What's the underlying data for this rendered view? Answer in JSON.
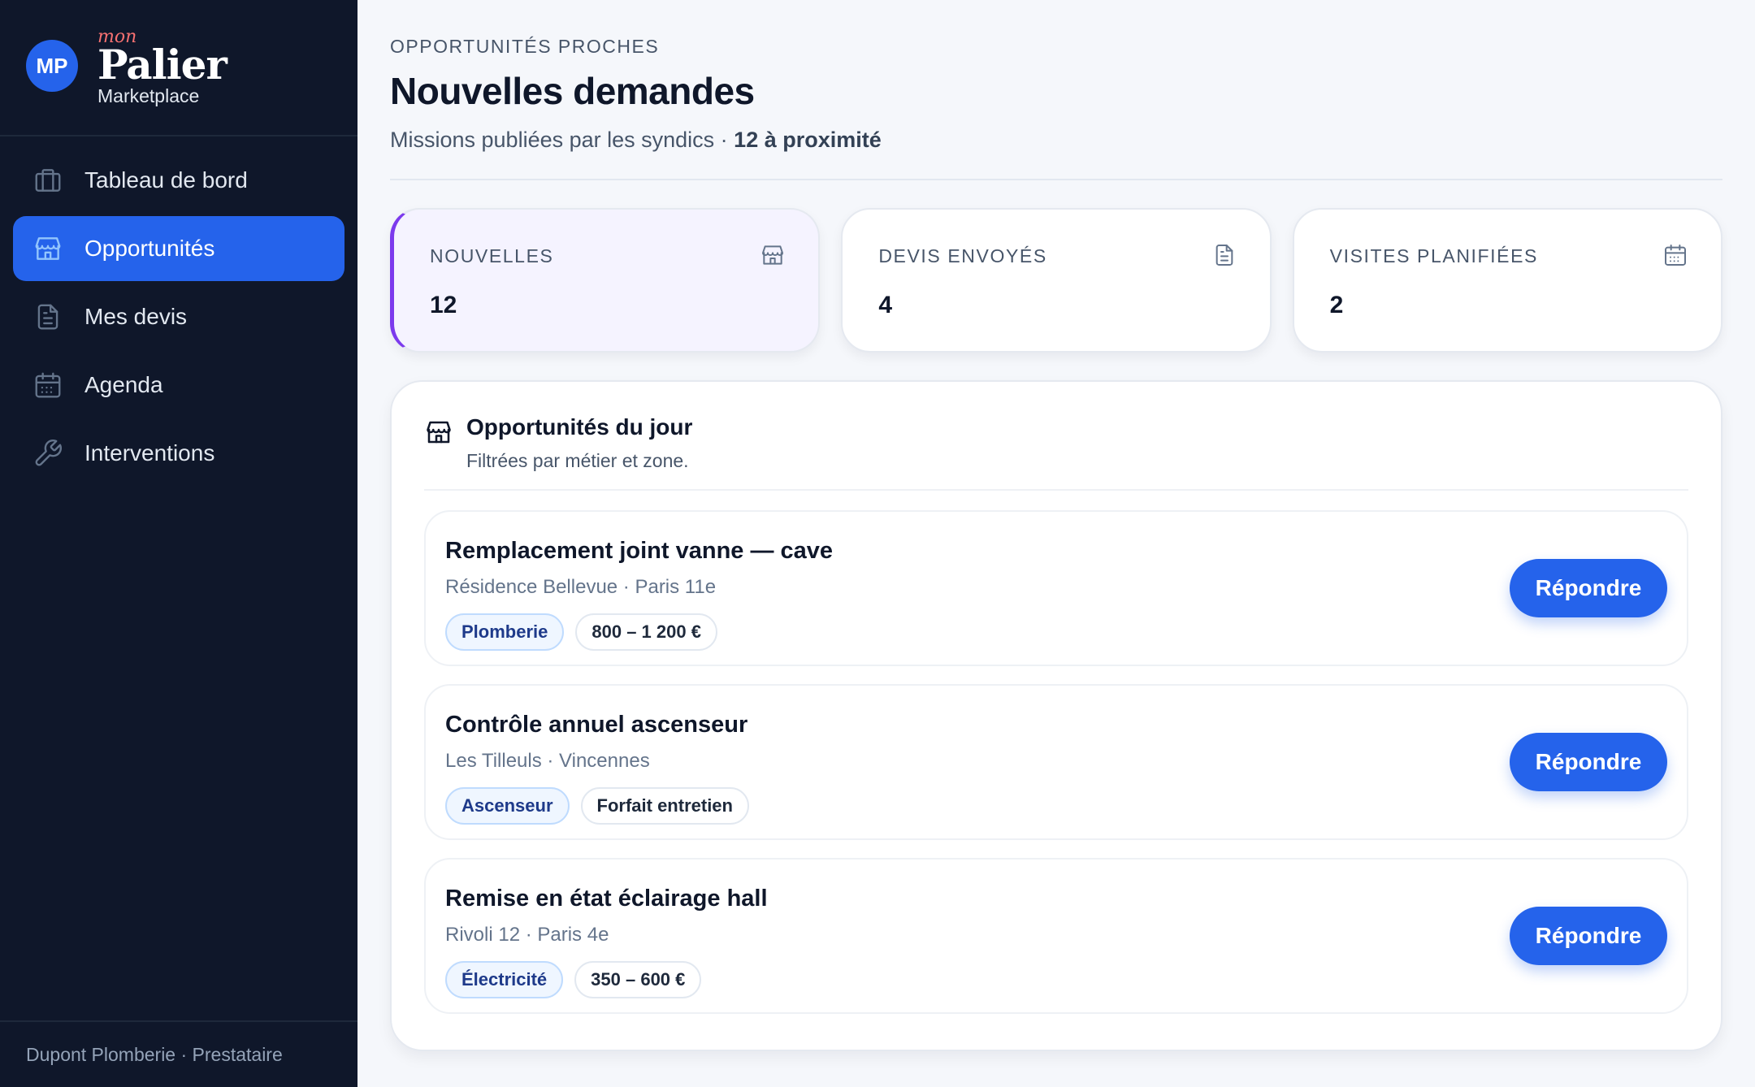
{
  "brand": {
    "initials": "MP",
    "mon": "mon",
    "name": "Palier",
    "sub": "Marketplace"
  },
  "nav": [
    {
      "label": "Tableau de bord",
      "icon": "briefcase-icon",
      "active": false
    },
    {
      "label": "Opportunités",
      "icon": "storefront-icon",
      "active": true
    },
    {
      "label": "Mes devis",
      "icon": "document-icon",
      "active": false
    },
    {
      "label": "Agenda",
      "icon": "calendar-icon",
      "active": false
    },
    {
      "label": "Interventions",
      "icon": "wrench-icon",
      "active": false
    }
  ],
  "footer": {
    "user": "Dupont Plomberie · Prestataire"
  },
  "header": {
    "eyebrow": "OPPORTUNITÉS PROCHES",
    "title": "Nouvelles demandes",
    "subtitle": "Missions publiées par les syndics · ",
    "subtitle_strong": "12 à proximité"
  },
  "stats": [
    {
      "label": "NOUVELLES",
      "value": "12",
      "icon": "storefront-icon"
    },
    {
      "label": "DEVIS ENVOYÉS",
      "value": "4",
      "icon": "document-icon"
    },
    {
      "label": "VISITES PLANIFIÉES",
      "value": "2",
      "icon": "calendar-icon"
    }
  ],
  "daily": {
    "title": "Opportunités du jour",
    "subtitle": "Filtrées par métier et zone.",
    "items": [
      {
        "title": "Remplacement joint vanne — cave",
        "location": "Résidence Bellevue · Paris 11e",
        "trade": "Plomberie",
        "price": "800 – 1 200 €",
        "action": "Répondre"
      },
      {
        "title": "Contrôle annuel ascenseur",
        "location": "Les Tilleuls · Vincennes",
        "trade": "Ascenseur",
        "price": "Forfait entretien",
        "action": "Répondre"
      },
      {
        "title": "Remise en état éclairage hall",
        "location": "Rivoli 12 · Paris 4e",
        "trade": "Électricité",
        "price": "350 – 600 €",
        "action": "Répondre"
      }
    ]
  },
  "colors": {
    "sidebar": "#0f172a",
    "accent": "#2563eb",
    "highlight": "#7c3aed"
  }
}
